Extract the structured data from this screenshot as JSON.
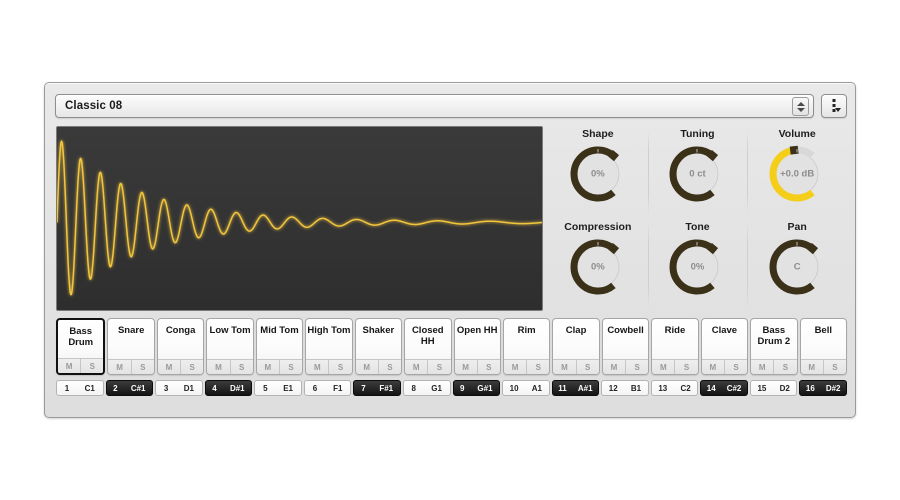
{
  "header": {
    "preset_name": "Classic 08",
    "stepper_icon": "stepper-up-down-icon",
    "menu_icon": "vertical-dots-menu-icon"
  },
  "waveform": {
    "name": "bass-drum-waveform",
    "line_color": "#F2C53D",
    "background_color": "#333333",
    "description": "decaying sine oscillation"
  },
  "knobs": [
    {
      "label": "Shape",
      "value": "0%",
      "arc_color": "#3b3118",
      "fill_pct": 0,
      "accent": false
    },
    {
      "label": "Tuning",
      "value": "0 ct",
      "arc_color": "#3b3118",
      "fill_pct": 0,
      "accent": false
    },
    {
      "label": "Volume",
      "value": "+0.0 dB",
      "arc_color": "#F5CE1A",
      "fill_pct": 82,
      "accent": true
    },
    {
      "label": "Compression",
      "value": "0%",
      "arc_color": "#3b3118",
      "fill_pct": 0,
      "accent": false
    },
    {
      "label": "Tone",
      "value": "0%",
      "arc_color": "#3b3118",
      "fill_pct": 0,
      "accent": false
    },
    {
      "label": "Pan",
      "value": "C",
      "arc_color": "#3b3118",
      "fill_pct": 0,
      "accent": false
    }
  ],
  "mute_label": "M",
  "solo_label": "S",
  "pads": [
    {
      "name": "Bass Drum",
      "selected": true
    },
    {
      "name": "Snare",
      "selected": false
    },
    {
      "name": "Conga",
      "selected": false
    },
    {
      "name": "Low Tom",
      "selected": false
    },
    {
      "name": "Mid Tom",
      "selected": false
    },
    {
      "name": "High Tom",
      "selected": false
    },
    {
      "name": "Shaker",
      "selected": false
    },
    {
      "name": "Closed HH",
      "selected": false
    },
    {
      "name": "Open HH",
      "selected": false
    },
    {
      "name": "Rim",
      "selected": false
    },
    {
      "name": "Clap",
      "selected": false
    },
    {
      "name": "Cowbell",
      "selected": false
    },
    {
      "name": "Ride",
      "selected": false
    },
    {
      "name": "Clave",
      "selected": false
    },
    {
      "name": "Bass Drum 2",
      "selected": false
    },
    {
      "name": "Bell",
      "selected": false
    }
  ],
  "keys": [
    {
      "index": "1",
      "note": "C1",
      "black": false
    },
    {
      "index": "2",
      "note": "C#1",
      "black": true
    },
    {
      "index": "3",
      "note": "D1",
      "black": false
    },
    {
      "index": "4",
      "note": "D#1",
      "black": true
    },
    {
      "index": "5",
      "note": "E1",
      "black": false
    },
    {
      "index": "6",
      "note": "F1",
      "black": false
    },
    {
      "index": "7",
      "note": "F#1",
      "black": true
    },
    {
      "index": "8",
      "note": "G1",
      "black": false
    },
    {
      "index": "9",
      "note": "G#1",
      "black": true
    },
    {
      "index": "10",
      "note": "A1",
      "black": false
    },
    {
      "index": "11",
      "note": "A#1",
      "black": true
    },
    {
      "index": "12",
      "note": "B1",
      "black": false
    },
    {
      "index": "13",
      "note": "C2",
      "black": false
    },
    {
      "index": "14",
      "note": "C#2",
      "black": true
    },
    {
      "index": "15",
      "note": "D2",
      "black": false
    },
    {
      "index": "16",
      "note": "D#2",
      "black": true
    }
  ]
}
